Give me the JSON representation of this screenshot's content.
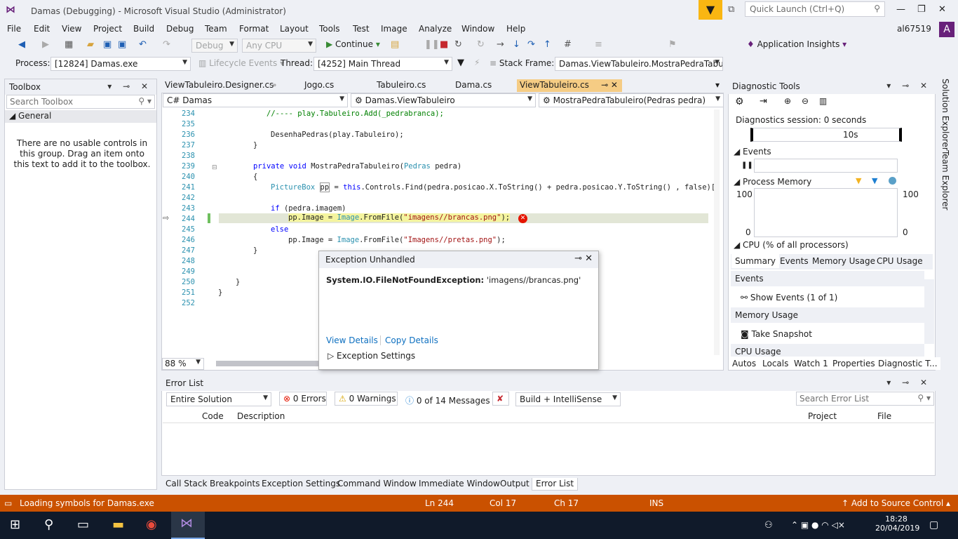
{
  "window": {
    "title": "Damas (Debugging) - Microsoft Visual Studio  (Administrator)",
    "quick_launch": "Quick Launch (Ctrl+Q)",
    "user": "al67519",
    "avatar_letter": "A"
  },
  "menu": [
    "File",
    "Edit",
    "View",
    "Project",
    "Build",
    "Debug",
    "Team",
    "Format",
    "Layout",
    "Tools",
    "Test",
    "Image",
    "Analyze",
    "Window",
    "Help"
  ],
  "toolbar": {
    "config": "Debug",
    "platform": "Any CPU",
    "continue": "Continue",
    "app_insights": "Application Insights"
  },
  "toolbar2": {
    "process_label": "Process:",
    "process": "[12824] Damas.exe",
    "lifecycle": "Lifecycle Events",
    "thread_label": "Thread:",
    "thread": "[4252] Main Thread",
    "stack_label": "Stack Frame:",
    "stack": "Damas.ViewTabuleiro.MostraPedraTabulei"
  },
  "toolbox": {
    "title": "Toolbox",
    "search": "Search Toolbox",
    "group": "General",
    "message": "There are no usable controls in this group. Drag an item onto this text to add it to the toolbox."
  },
  "tabs": [
    "ViewTabuleiro.Designer.cs",
    "Jogo.cs",
    "Tabuleiro.cs",
    "Dama.cs",
    "ViewTabuleiro.cs"
  ],
  "nav": {
    "project": "Damas",
    "class": "Damas.ViewTabuleiro",
    "member": "MostraPedraTabuleiro(Pedras pedra)"
  },
  "code": {
    "lines": [
      "234",
      "235",
      "236",
      "237",
      "238",
      "239",
      "240",
      "241",
      "242",
      "243",
      "244",
      "245",
      "246",
      "247",
      "248",
      "249",
      "250",
      "251",
      "252"
    ],
    "l234": "//---- play.Tabuleiro.Add(_pedrabranca);",
    "l236": "DesenhaPedras(play.Tabuleiro);",
    "l239a": "private void ",
    "l239b": "MostraPedraTabuleiro(",
    "l239c": "Pedras",
    " l239d": " pedra)",
    "l241a": "PictureBox",
    " l241b": " pp = ",
    "l241c": "this",
    ".l241d": ".Controls.Find(pedra.posicao.X.ToString() + pedra.posicao.Y.ToString() , false)[",
    "l243": "if (pedra.imagem)",
    "l244a": "pp.Image = ",
    "l244b": "Image",
    ".l244c": ".FromFile(",
    "l244d": "\"imagens//brancas.png\"",
    "l244e": ");",
    "l245": "else",
    "l246a": "pp.Image = ",
    "l246b": "Image",
    "l246c": ".FromFile(",
    "l246d": "\"Imagens//pretas.png\"",
    "l246e": ");",
    "zoom": "88 %"
  },
  "exception": {
    "title": "Exception Unhandled",
    "type": "System.IO.FileNotFoundException:",
    "msg": "'imagens//brancas.png'",
    "view": "View Details",
    "copy": "Copy Details",
    "settings": "Exception Settings"
  },
  "diag": {
    "title": "Diagnostic Tools",
    "session": "Diagnostics session: 0 seconds",
    "tick": "10s",
    "events": "Events",
    "memory": "Process Memory",
    "m100": "100",
    "m0": "0",
    "cpu": "CPU (% of all processors)",
    "tabs": [
      "Summary",
      "Events",
      "Memory Usage",
      "CPU Usage"
    ],
    "s_events": "Events",
    "show_events": "Show Events (1 of 1)",
    "s_mem": "Memory Usage",
    "snapshot": "Take Snapshot",
    "s_cpu": "CPU Usage",
    "bottom_tabs": [
      "Autos",
      "Locals",
      "Watch 1",
      "Properties",
      "Diagnostic T..."
    ]
  },
  "side": [
    "Solution Explorer",
    "Team Explorer"
  ],
  "errlist": {
    "title": "Error List",
    "scope": "Entire Solution",
    "errors": "0 Errors",
    "warnings": "0 Warnings",
    "messages": "0 of 14 Messages",
    "build": "Build + IntelliSense",
    "search": "Search Error List",
    "cols": [
      "Code",
      "Description",
      "Project",
      "File"
    ]
  },
  "bottom_tabs": [
    "Call Stack",
    "Breakpoints",
    "Exception Settings",
    "Command Window",
    "Immediate Window",
    "Output",
    "Error List"
  ],
  "status": {
    "msg": "Loading symbols for Damas.exe",
    "ln": "Ln 244",
    "col": "Col 17",
    "ch": "Ch 17",
    "ins": "INS",
    "source": "Add to Source Control"
  },
  "taskbar": {
    "time": "18:28",
    "date": "20/04/2019"
  },
  "colors": {
    "accent": "#68217a",
    "status": "#ca5100",
    "tab_active": "#f5cc84"
  }
}
